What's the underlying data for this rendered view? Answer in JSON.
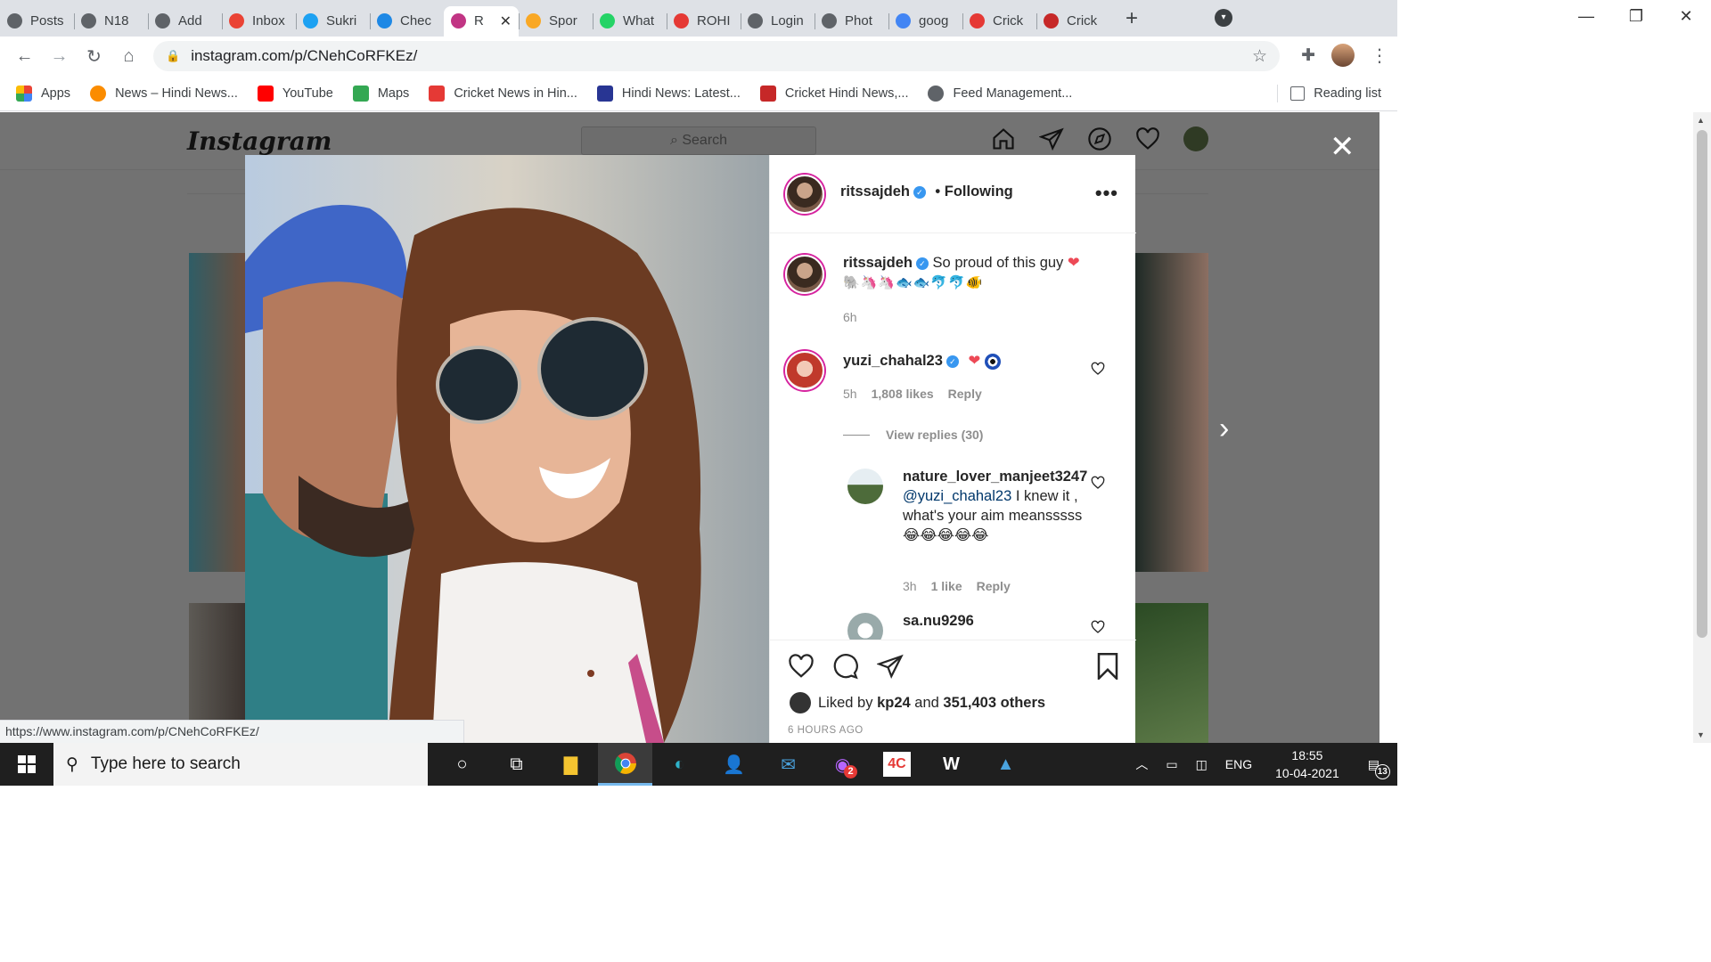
{
  "browser": {
    "tabs": [
      {
        "title": "Posts",
        "icon": "globe-icon",
        "color": "#5f6368"
      },
      {
        "title": "N18",
        "icon": "globe-icon",
        "color": "#5f6368"
      },
      {
        "title": "Add",
        "icon": "globe-icon",
        "color": "#5f6368"
      },
      {
        "title": "Inbox",
        "icon": "gmail-icon",
        "color": "#ea4335"
      },
      {
        "title": "Sukri",
        "icon": "twitter-icon",
        "color": "#1da1f2"
      },
      {
        "title": "Chec",
        "icon": "edge-like-icon",
        "color": "#1e88e5"
      },
      {
        "title": "R",
        "icon": "instagram-icon",
        "color": "#c13584",
        "active": true
      },
      {
        "title": "Spor",
        "icon": "circle-icon",
        "color": "#f9a825"
      },
      {
        "title": "What",
        "icon": "whatsapp-icon",
        "color": "#25d366"
      },
      {
        "title": "ROHI",
        "icon": "brand-icon",
        "color": "#e53935"
      },
      {
        "title": "Login",
        "icon": "globe-icon",
        "color": "#5f6368"
      },
      {
        "title": "Phot",
        "icon": "globe-icon",
        "color": "#5f6368"
      },
      {
        "title": "goog",
        "icon": "google-icon",
        "color": "#4285f4"
      },
      {
        "title": "Crick",
        "icon": "n18-icon",
        "color": "#e53935"
      },
      {
        "title": "Crick",
        "icon": "tv9-icon",
        "color": "#c62828"
      }
    ],
    "url": "instagram.com/p/CNehCoRFKEz/",
    "status_url": "https://www.instagram.com/p/CNehCoRFKEz/",
    "bookmarks": [
      {
        "label": "Apps",
        "color": "#4285f4"
      },
      {
        "label": "News – Hindi News...",
        "color": "#fb8c00"
      },
      {
        "label": "YouTube",
        "color": "#ff0000"
      },
      {
        "label": "Maps",
        "color": "#34a853"
      },
      {
        "label": "Cricket News in Hin...",
        "color": "#e53935"
      },
      {
        "label": "Hindi News: Latest...",
        "color": "#283593"
      },
      {
        "label": "Cricket Hindi News,...",
        "color": "#c62828"
      },
      {
        "label": "Feed Management...",
        "color": "#5f6368"
      }
    ],
    "reading_list": "Reading list"
  },
  "instagram": {
    "logo": "Instagram",
    "search_placeholder": "Search"
  },
  "post": {
    "author": "ritssajdeh",
    "follow_status": "• Following",
    "caption_user": "ritssajdeh",
    "caption": "So proud of this guy",
    "caption_emojis": "🐘🦄🦄🐟🐟🐬🐬🐠",
    "caption_time": "6h",
    "comments": [
      {
        "user": "yuzi_chahal23",
        "text": "",
        "time": "5h",
        "likes": "1,808 likes",
        "reply": "Reply"
      }
    ],
    "view_replies": "View replies (30)",
    "replies": [
      {
        "user": "nature_lover_manjeet3247",
        "mention": "@yuzi_chahal23",
        "text": "I knew it , what's your aim meansssss😂😂😂😂😂",
        "time": "3h",
        "likes": "1 like",
        "reply": "Reply"
      },
      {
        "user": "sa.nu9296"
      }
    ],
    "liked_prefix": "Liked by",
    "liked_user": "kp24",
    "liked_and": "and",
    "liked_others": "351,403 others",
    "time_ago": "6 HOURS AGO"
  },
  "taskbar": {
    "search_placeholder": "Type here to search",
    "language": "ENG",
    "time": "18:55",
    "date": "10-04-2021",
    "notifications": "13",
    "messenger_badge": "2"
  },
  "colors": {
    "verified": "#3897f0",
    "heart": "#ed4956",
    "story_ring": "#d6249f"
  }
}
